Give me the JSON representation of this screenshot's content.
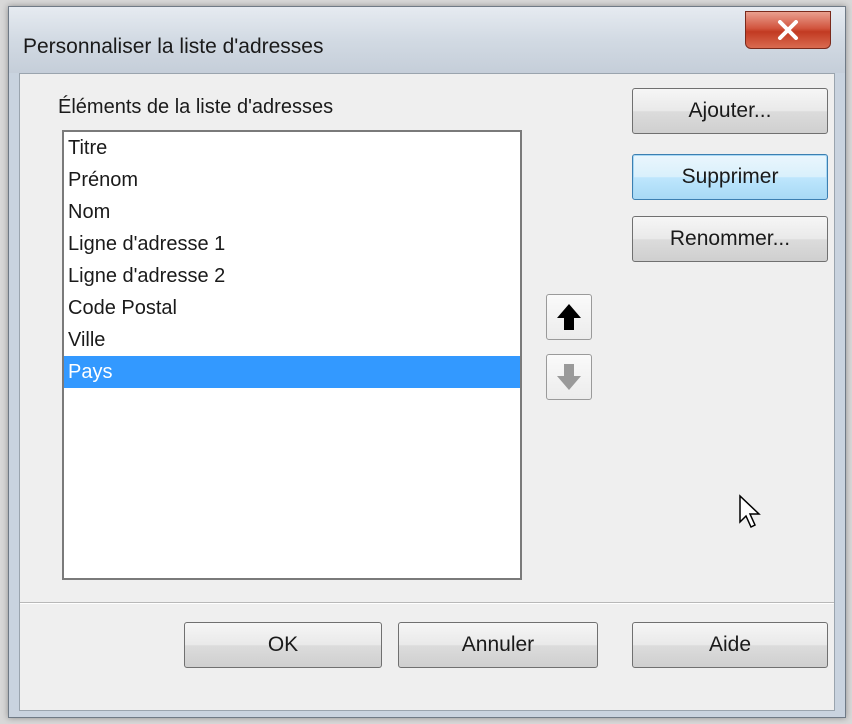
{
  "window": {
    "title": "Personnaliser la liste d'adresses"
  },
  "icons": {
    "close": "close-x-icon",
    "move_up": "arrow-up-icon",
    "move_down": "arrow-down-icon",
    "cursor": "mouse-pointer-icon"
  },
  "list": {
    "label": "Éléments de la liste d'adresses",
    "items": [
      {
        "label": "Titre",
        "selected": false
      },
      {
        "label": "Prénom",
        "selected": false
      },
      {
        "label": "Nom",
        "selected": false
      },
      {
        "label": "Ligne d'adresse 1",
        "selected": false
      },
      {
        "label": "Ligne d'adresse 2",
        "selected": false
      },
      {
        "label": "Code Postal",
        "selected": false
      },
      {
        "label": "Ville",
        "selected": false
      },
      {
        "label": "Pays",
        "selected": true
      }
    ]
  },
  "buttons": {
    "add": "Ajouter...",
    "delete": "Supprimer",
    "rename": "Renommer...",
    "ok": "OK",
    "cancel": "Annuler",
    "help": "Aide"
  },
  "colors": {
    "selection": "#3399ff",
    "close_button": "#c8442c"
  }
}
